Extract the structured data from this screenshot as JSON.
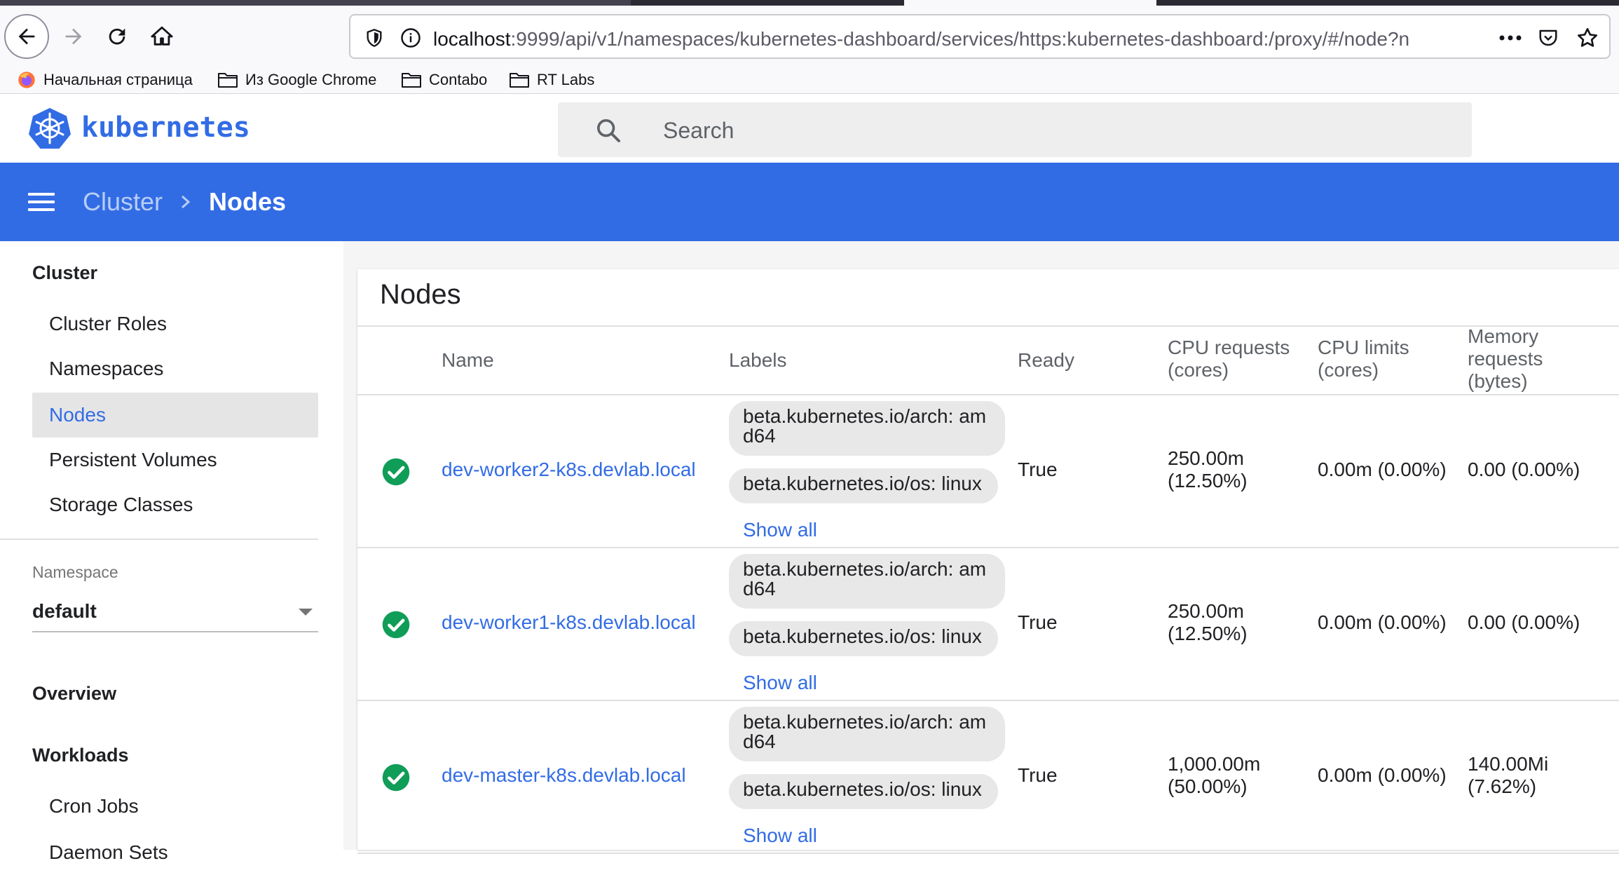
{
  "browser": {
    "url_host": "localhost",
    "url_rest": ":9999/api/v1/namespaces/kubernetes-dashboard/services/https:kubernetes-dashboard:/proxy/#/node?n",
    "bookmarks": [
      "Начальная страница",
      "Из Google Chrome",
      "Contabo",
      "RT Labs"
    ]
  },
  "header": {
    "logo_text": "kubernetes",
    "search_placeholder": "Search"
  },
  "toolbar": {
    "breadcrumb_parent": "Cluster",
    "breadcrumb_current": "Nodes"
  },
  "sidebar": {
    "cluster_heading": "Cluster",
    "cluster_items": [
      "Cluster Roles",
      "Namespaces",
      "Nodes",
      "Persistent Volumes",
      "Storage Classes"
    ],
    "active_item": "Nodes",
    "namespace_label": "Namespace",
    "namespace_value": "default",
    "overview_heading": "Overview",
    "workloads_heading": "Workloads",
    "workloads_items": [
      "Cron Jobs",
      "Daemon Sets"
    ]
  },
  "main": {
    "title": "Nodes",
    "columns": {
      "name": "Name",
      "labels": "Labels",
      "ready": "Ready",
      "cpu_requests": [
        "CPU requests",
        "(cores)"
      ],
      "cpu_limits": [
        "CPU limits",
        "(cores)"
      ],
      "memory_requests": [
        "Memory",
        "requests",
        "(bytes)"
      ]
    },
    "show_all_label": "Show all",
    "rows": [
      {
        "status": "ready",
        "name": "dev-worker2-k8s.devlab.local",
        "label_arch": [
          "beta.kubernetes.io/arch: am",
          "d64"
        ],
        "label_os": "beta.kubernetes.io/os: linux",
        "ready": "True",
        "cpu_requests": [
          "250.00m",
          "(12.50%)"
        ],
        "cpu_limits": "0.00m (0.00%)",
        "memory_requests": [
          "0.00 (0.00%)"
        ]
      },
      {
        "status": "ready",
        "name": "dev-worker1-k8s.devlab.local",
        "label_arch": [
          "beta.kubernetes.io/arch: am",
          "d64"
        ],
        "label_os": "beta.kubernetes.io/os: linux",
        "ready": "True",
        "cpu_requests": [
          "250.00m",
          "(12.50%)"
        ],
        "cpu_limits": "0.00m (0.00%)",
        "memory_requests": [
          "0.00 (0.00%)"
        ]
      },
      {
        "status": "ready",
        "name": "dev-master-k8s.devlab.local",
        "label_arch": [
          "beta.kubernetes.io/arch: am",
          "d64"
        ],
        "label_os": "beta.kubernetes.io/os: linux",
        "ready": "True",
        "cpu_requests": [
          "1,000.00m",
          "(50.00%)"
        ],
        "cpu_limits": "0.00m (0.00%)",
        "memory_requests": [
          "140.00Mi",
          "(7.62%)"
        ]
      }
    ]
  },
  "colors": {
    "brand_blue": "#326ce5",
    "status_green": "#0f9d58"
  }
}
